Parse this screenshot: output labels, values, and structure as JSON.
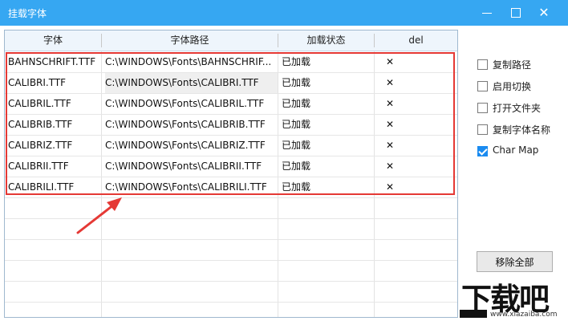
{
  "window": {
    "title": "挂载字体",
    "controls": {
      "minimize_icon": "minimize-icon",
      "maximize_icon": "maximize-icon",
      "close_glyph": "✕"
    }
  },
  "table": {
    "columns": [
      "字体",
      "字体路径",
      "加载状态",
      "del"
    ],
    "rows": [
      {
        "font": "BAHNSCHRIFT.TTF",
        "path": "C:\\WINDOWS\\Fonts\\BAHNSCHRIF...",
        "status": "已加载",
        "del": "✕"
      },
      {
        "font": "CALIBRI.TTF",
        "path": "C:\\WINDOWS\\Fonts\\CALIBRI.TTF",
        "status": "已加载",
        "del": "✕"
      },
      {
        "font": "CALIBRIL.TTF",
        "path": "C:\\WINDOWS\\Fonts\\CALIBRIL.TTF",
        "status": "已加载",
        "del": "✕"
      },
      {
        "font": "CALIBRIB.TTF",
        "path": "C:\\WINDOWS\\Fonts\\CALIBRIB.TTF",
        "status": "已加载",
        "del": "✕"
      },
      {
        "font": "CALIBRIZ.TTF",
        "path": "C:\\WINDOWS\\Fonts\\CALIBRIZ.TTF",
        "status": "已加载",
        "del": "✕"
      },
      {
        "font": "CALIBRII.TTF",
        "path": "C:\\WINDOWS\\Fonts\\CALIBRII.TTF",
        "status": "已加载",
        "del": "✕"
      },
      {
        "font": "CALIBRILI.TTF",
        "path": "C:\\WINDOWS\\Fonts\\CALIBRILI.TTF",
        "status": "已加载",
        "del": "✕"
      }
    ],
    "highlight_color": "#e53935"
  },
  "options": {
    "items": [
      {
        "label": "复制路径",
        "checked": false
      },
      {
        "label": "启用切换",
        "checked": false
      },
      {
        "label": "打开文件夹",
        "checked": false
      },
      {
        "label": "复制字体名称",
        "checked": false
      },
      {
        "label": "Char Map",
        "checked": true
      }
    ],
    "remove_all_label": "移除全部"
  },
  "watermark": {
    "brand": "下载吧",
    "url": "www.xiazaiba.com"
  },
  "colors": {
    "titlebar": "#36a7f2",
    "accent": "#1a8bf0"
  }
}
